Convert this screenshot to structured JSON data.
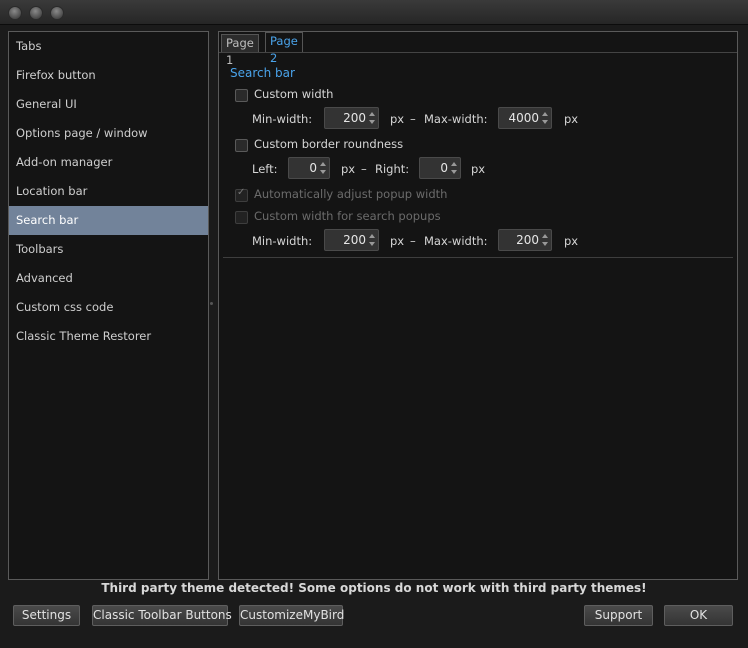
{
  "sidebar": {
    "items": [
      {
        "label": "Tabs"
      },
      {
        "label": "Firefox button"
      },
      {
        "label": "General UI"
      },
      {
        "label": "Options page / window"
      },
      {
        "label": "Add-on manager"
      },
      {
        "label": "Location bar"
      },
      {
        "label": "Search bar",
        "selected": true
      },
      {
        "label": "Toolbars"
      },
      {
        "label": "Advanced"
      },
      {
        "label": "Custom css code"
      },
      {
        "label": "Classic Theme Restorer"
      }
    ]
  },
  "tabs": [
    {
      "label": "Page 1",
      "active": false
    },
    {
      "label": "Page 2",
      "active": true
    }
  ],
  "section": {
    "title": "Search bar",
    "custom_width": {
      "label": "Custom width",
      "checked": false
    },
    "min_width_label": "Min-width:",
    "min_width_value": "200",
    "px": "px",
    "dash": "–",
    "max_width_label": "Max-width:",
    "max_width_value": "4000",
    "border_roundness": {
      "label": "Custom border roundness",
      "checked": false
    },
    "left_label": "Left:",
    "left_value": "0",
    "right_label": "Right:",
    "right_value": "0",
    "auto_adjust": {
      "label": "Automatically adjust popup width",
      "checked": true,
      "disabled": true
    },
    "popup_width": {
      "label": "Custom width for search popups",
      "checked": false,
      "disabled": true
    },
    "popup_min_label": "Min-width:",
    "popup_min_value": "200",
    "popup_max_label": "Max-width:",
    "popup_max_value": "200"
  },
  "warning": "Third party theme detected! Some options do not work with third party themes!",
  "buttons": {
    "settings": "Settings",
    "classic_toolbar": "Classic Toolbar Buttons",
    "customize": "CustomizeMyBird",
    "support": "Support",
    "ok": "OK"
  }
}
